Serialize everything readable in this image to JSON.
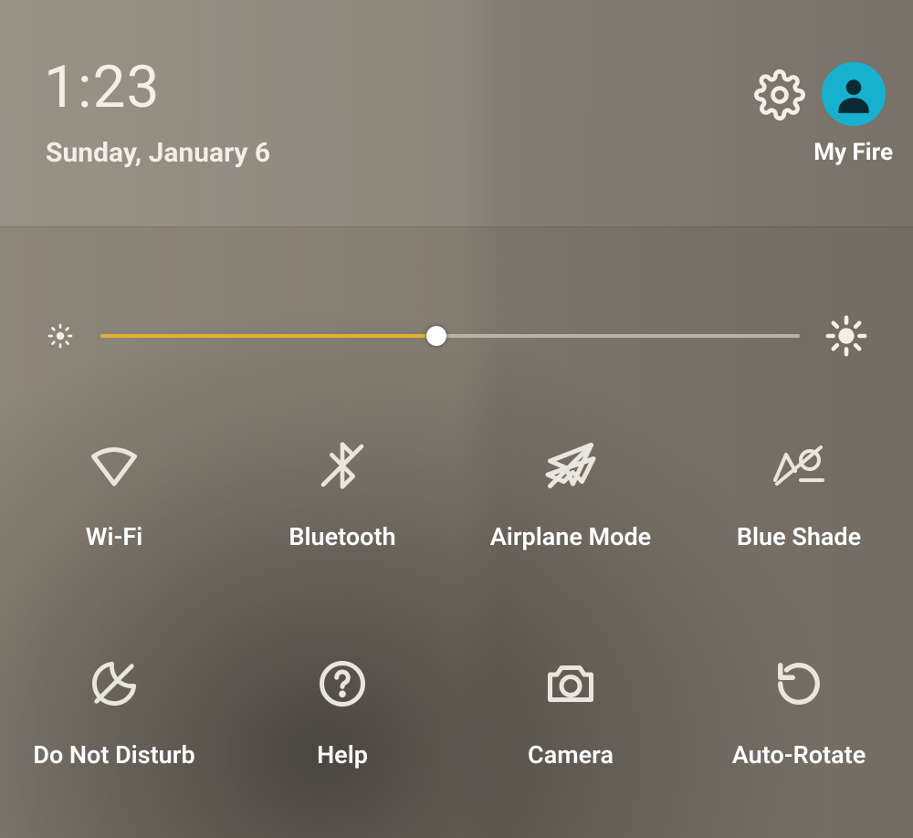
{
  "header": {
    "time": "1:23",
    "date": "Sunday, January 6",
    "user_label": "My Fire"
  },
  "brightness": {
    "percent": 48
  },
  "tiles": {
    "wifi": "Wi-Fi",
    "bluetooth": "Bluetooth",
    "airplane": "Airplane Mode",
    "blueshade": "Blue Shade",
    "dnd": "Do Not Disturb",
    "help": "Help",
    "camera": "Camera",
    "autorotate": "Auto-Rotate"
  },
  "colors": {
    "accent": "#15b1cf",
    "slider_fill": "#e0b32e"
  }
}
